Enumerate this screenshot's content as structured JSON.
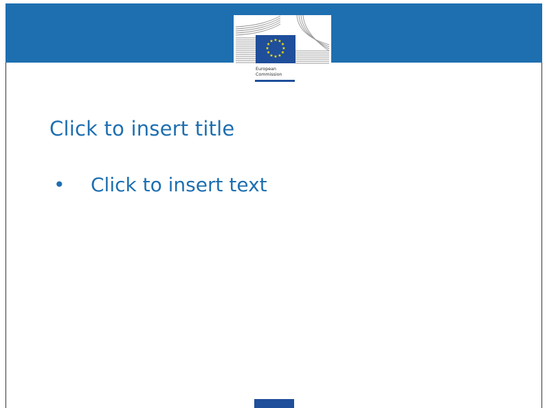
{
  "slide": {
    "logo": {
      "org_line1": "European",
      "org_line2": "Commission"
    },
    "title_placeholder": "Click to insert title",
    "body": {
      "bullet": "•",
      "text_placeholder": "Click to insert text"
    }
  },
  "colors": {
    "band": "#1e6fb0",
    "text": "#1e6fb0",
    "flag": "#1f4e9a",
    "stars": "#ffe600"
  },
  "icons": [
    "berlaymont-building-icon",
    "eu-flag-icon"
  ]
}
